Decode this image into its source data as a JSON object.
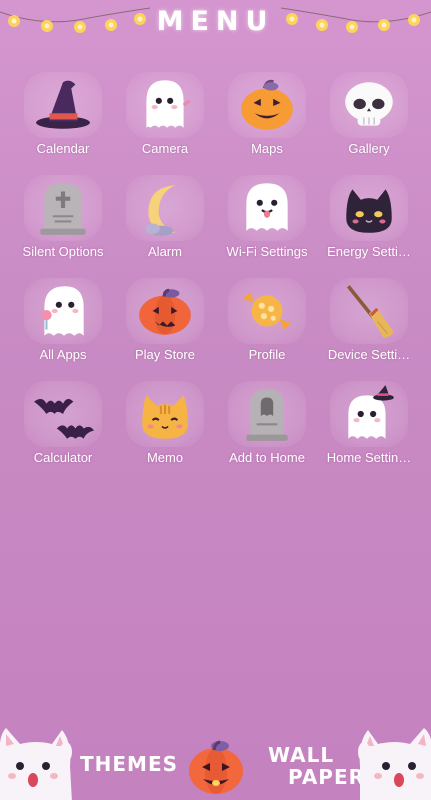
{
  "header": {
    "title": "MENU"
  },
  "apps": [
    {
      "label": "Calendar",
      "icon": "witch-hat-icon"
    },
    {
      "label": "Camera",
      "icon": "ghost-icon"
    },
    {
      "label": "Maps",
      "icon": "jack-o-lantern-icon"
    },
    {
      "label": "Gallery",
      "icon": "skull-icon"
    },
    {
      "label": "Silent Options",
      "icon": "tombstone-icon"
    },
    {
      "label": "Alarm",
      "icon": "crescent-moon-icon"
    },
    {
      "label": "Wi-Fi Settings",
      "icon": "ghost-tongue-icon"
    },
    {
      "label": "Energy Setti…",
      "icon": "black-cat-icon"
    },
    {
      "label": "All Apps",
      "icon": "ghost-lollipop-icon"
    },
    {
      "label": "Play Store",
      "icon": "pumpkin-icon"
    },
    {
      "label": "Profile",
      "icon": "candy-icon"
    },
    {
      "label": "Device Setti…",
      "icon": "broom-icon"
    },
    {
      "label": "Calculator",
      "icon": "bats-icon"
    },
    {
      "label": "Memo",
      "icon": "orange-cat-icon"
    },
    {
      "label": "Add to Home",
      "icon": "ghost-tombstone-icon"
    },
    {
      "label": "Home Settin…",
      "icon": "ghost-witch-icon"
    }
  ],
  "dock": {
    "themes_label": "THEMES",
    "wallpapers_line1": "WALL",
    "wallpapers_line2": "PAPERS",
    "center_icon": "jack-o-lantern-icon"
  },
  "colors": {
    "background": "#c98ac3",
    "text": "#ffffff",
    "pumpkin": "#f47a2e",
    "ghost": "#ffffff"
  }
}
